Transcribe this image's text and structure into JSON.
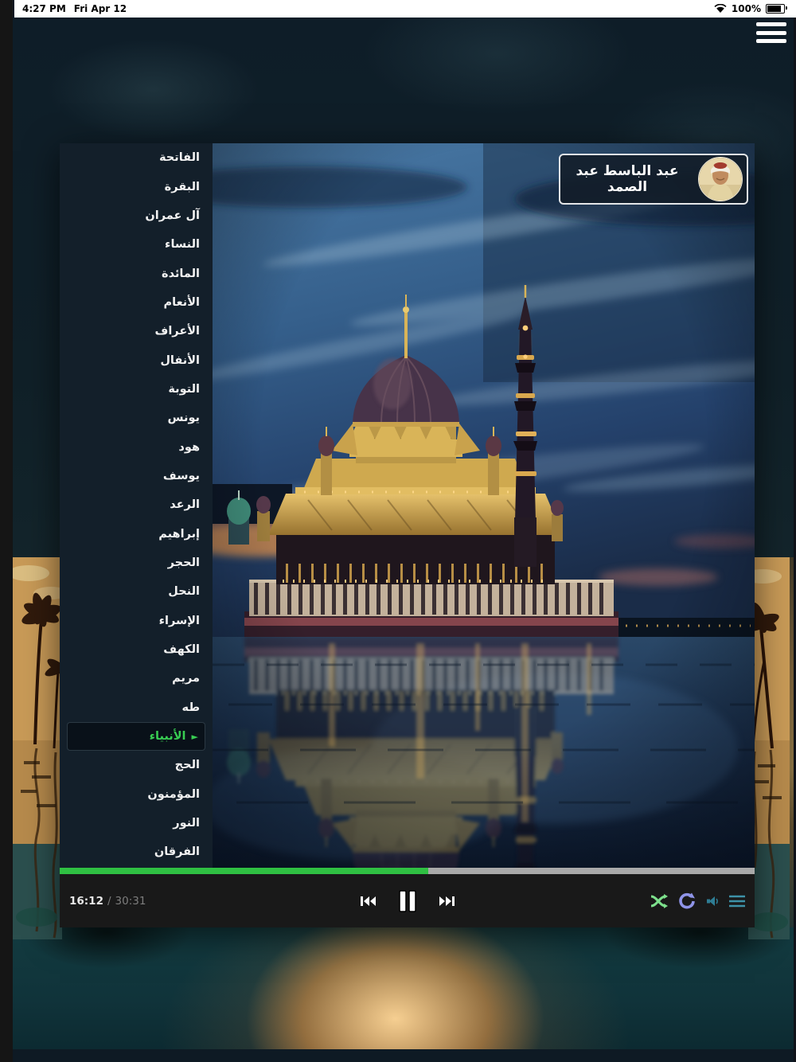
{
  "status_bar": {
    "time": "4:27 PM",
    "date": "Fri Apr 12",
    "battery": "100%"
  },
  "header": {
    "menu_icon": "hamburger-menu"
  },
  "reciter": {
    "name": "عبد الباسط عبد الصمد"
  },
  "surah_list": {
    "items": [
      "الفاتحة",
      "البقرة",
      "آل عمران",
      "النساء",
      "المائدة",
      "الأنعام",
      "الأعراف",
      "الأنفال",
      "التوبة",
      "يونس",
      "هود",
      "يوسف",
      "الرعد",
      "إبراهيم",
      "الحجر",
      "النحل",
      "الإسراء",
      "الكهف",
      "مريم",
      "طه",
      "الأنبياء",
      "الحج",
      "المؤمنون",
      "النور",
      "الفرقان"
    ],
    "selected_index": 20,
    "selected_color": "#38cd52",
    "play_glyph": "►"
  },
  "player": {
    "elapsed": "16:12",
    "separator": "/",
    "duration": "30:31",
    "progress_percent": 53,
    "progress_color": "#2fc042",
    "controls": {
      "previous": "previous",
      "pause": "pause",
      "next": "next"
    },
    "right_icons": [
      "shuffle-icon",
      "repeat-icon",
      "volume-icon",
      "queue-icon"
    ]
  },
  "colors": {
    "sidebar_bg": "#131f2a",
    "controls_bg": "#191919",
    "progress_rest": "#a9a9a9",
    "shuffle": "#7de08c",
    "repeat": "#8f94e8",
    "volume_teal": "#2e7d94"
  }
}
